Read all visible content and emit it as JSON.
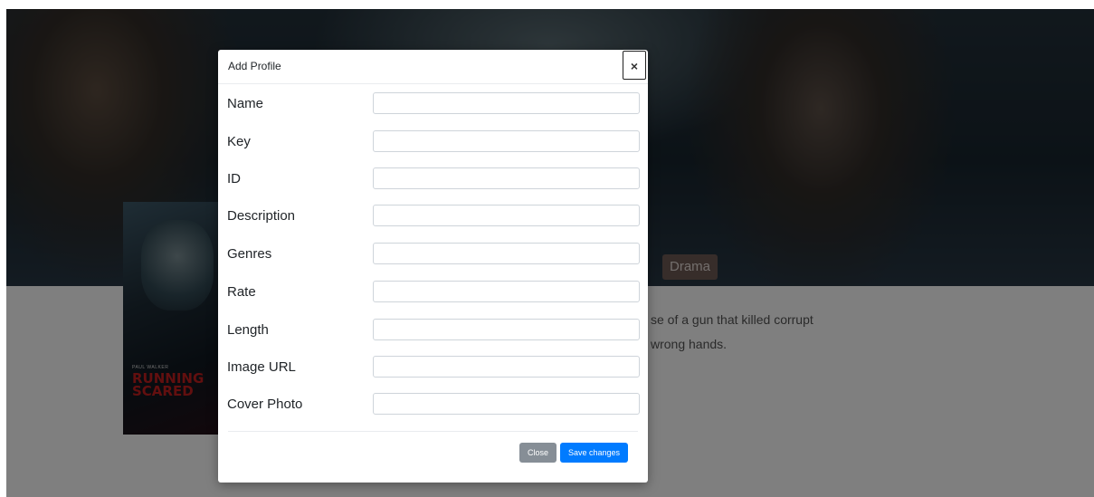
{
  "background": {
    "genres": [
      "",
      "Drama"
    ],
    "description_lines": [
      "se of a gun that killed corrupt",
      "wrong hands."
    ],
    "poster": {
      "credit": "PAUL WALKER",
      "title_lines": [
        "RUNNING",
        "SCARED"
      ]
    }
  },
  "modal": {
    "title": "Add Profile",
    "close_symbol": "×",
    "fields": [
      {
        "label": "Name",
        "value": "",
        "placeholder": ""
      },
      {
        "label": "Key",
        "value": "",
        "placeholder": ""
      },
      {
        "label": "ID",
        "value": "",
        "placeholder": ""
      },
      {
        "label": "Description",
        "value": "",
        "placeholder": ""
      },
      {
        "label": "Genres",
        "value": "",
        "placeholder": ""
      },
      {
        "label": "Rate",
        "value": "",
        "placeholder": ""
      },
      {
        "label": "Length",
        "value": "",
        "placeholder": ""
      },
      {
        "label": "Image URL",
        "value": "",
        "placeholder": ""
      },
      {
        "label": "Cover Photo",
        "value": "",
        "placeholder": ""
      }
    ],
    "buttons": {
      "close_label": "Close",
      "save_label": "Save changes"
    }
  },
  "colors": {
    "primary": "#007bff",
    "secondary": "#868e96",
    "badge": "#6e5a55"
  }
}
